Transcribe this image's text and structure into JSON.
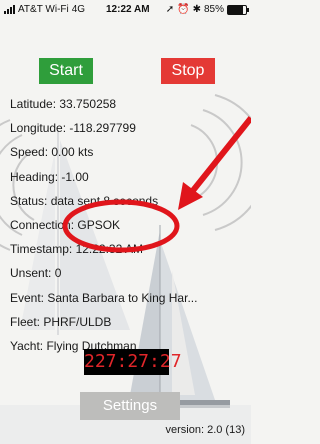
{
  "status_bar": {
    "carrier": "AT&T Wi-Fi",
    "network": "4G",
    "time": "12:22 AM",
    "battery_text": "85%",
    "battery_level": 0.85
  },
  "controls": {
    "start_label": "Start",
    "stop_label": "Stop"
  },
  "info": {
    "latitude": "Latitude: 33.750258",
    "longitude": "Longitude: -118.297799",
    "speed": "Speed: 0.00 kts",
    "heading": "Heading: -1.00",
    "status": "Status: data sent 8 seconds",
    "connection": "Connection: GPSOK",
    "timestamp": "Timestamp: 12:22:32 AM",
    "unsent": "Unsent: 0",
    "event": "Event: Santa Barbara to King Har...",
    "fleet": "Fleet: PHRF/ULDB",
    "yacht": "Yacht: Flying Dutchman"
  },
  "timer": "227:27:27",
  "settings_label": "Settings",
  "version": "version: 2.0 (13)",
  "colors": {
    "start_green": "#2f9e3b",
    "stop_red": "#e43935",
    "annotation_red": "#e0151b",
    "timer_red": "#e0262a"
  },
  "icons": [
    "signal-bars-icon",
    "location-arrow-icon",
    "alarm-icon",
    "bluetooth-icon",
    "battery-icon"
  ]
}
